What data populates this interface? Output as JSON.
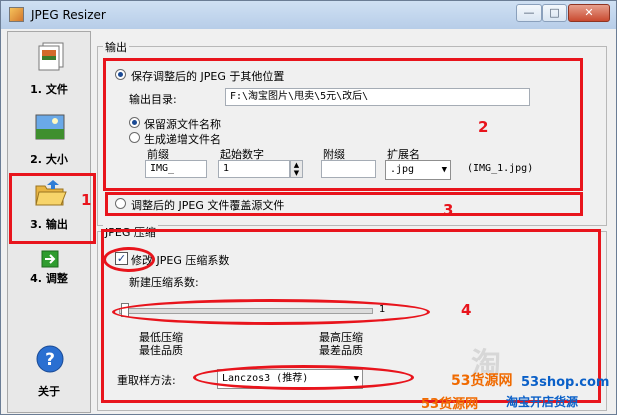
{
  "window": {
    "title": "JPEG Resizer",
    "minimize": "—",
    "maximize": "□",
    "close": "✕"
  },
  "sidebar": {
    "items": [
      {
        "label": "1. 文件",
        "icon": "file-stack-icon"
      },
      {
        "label": "2. 大小",
        "icon": "landscape-image-icon"
      },
      {
        "label": "3. 输出",
        "icon": "folder-open-icon"
      },
      {
        "label": "4. 调整",
        "icon": "green-arrow-icon"
      },
      {
        "label": "关于",
        "icon": "help-question-icon"
      }
    ]
  },
  "output_group": {
    "title": "输出",
    "save_elsewhere_label": "保存调整后的 JPEG 于其他位置",
    "output_dir_label": "输出目录:",
    "output_dir_value": "F:\\淘宝图片\\甩卖\\5元\\改后\\",
    "keep_name_label": "保留源文件名称",
    "generate_name_label": "生成递增文件名",
    "prefix_label": "前缀",
    "prefix_value": "IMG_",
    "start_label": "起始数字",
    "start_value": "1",
    "suffix_label": "附缀",
    "suffix_value": "",
    "ext_label": "扩展名",
    "ext_value": ".jpg",
    "preview": "(IMG_1.jpg)",
    "overwrite_label": "调整后的 JPEG 文件覆盖源文件"
  },
  "jpeg_group": {
    "title": "JPEG 压缩",
    "modify_label": "修改 JPEG 压缩系数",
    "modify_checked": true,
    "new_factor_label": "新建压缩系数:",
    "slider_value": "1",
    "slider_fraction": 0.0,
    "min_label_1": "最低压缩",
    "min_label_2": "最佳品质",
    "max_label_1": "最高压缩",
    "max_label_2": "最差品质",
    "resample_label": "重取样方法:",
    "resample_value": "Lanczos3 (推荐)"
  },
  "annotations": [
    "1",
    "2",
    "3",
    "4"
  ],
  "watermark": {
    "line1": "53货源网",
    "line2": "53shop.com",
    "line3": "53货源网",
    "line4": "淘宝开店货源",
    "ghost": "淘"
  },
  "colors": {
    "annotation_red": "#e8141c",
    "watermark_orange": "#f06a00",
    "watermark_blue": "#0a60c8"
  }
}
